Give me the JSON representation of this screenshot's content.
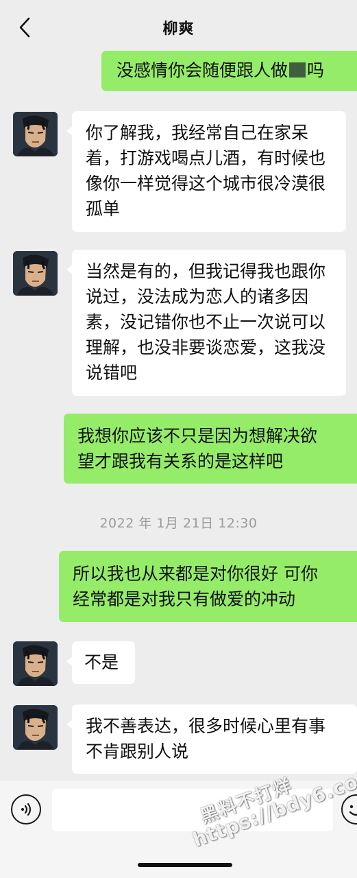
{
  "header": {
    "title": "柳爽",
    "back_icon": "chevron-left-icon"
  },
  "messages": [
    {
      "side": "right",
      "parts": [
        "没感情你会随便跟人做",
        "吗"
      ]
    },
    {
      "side": "left",
      "lines": [
        "你了解我，我经常自己在家呆",
        "着，打游戏喝点儿酒，有时候也",
        "像你一样觉得这个城市很冷漠很",
        "孤单"
      ]
    },
    {
      "side": "left",
      "lines": [
        "当然是有的，但我记得我也跟你",
        "说过，没法成为恋人的诸多因",
        "素，没记错你也不止一次说可以",
        "理解，也没非要谈恋爱，这我没",
        "说错吧"
      ]
    },
    {
      "side": "right",
      "lines": [
        "我想你应该不只是因为想解决欲",
        "望才跟我有关系的是这样吧"
      ]
    },
    {
      "side": "right",
      "lines": [
        "所以我也从来都是对你很好 可你",
        "经常都是对我只有做爱的冲动"
      ]
    },
    {
      "side": "left",
      "lines": [
        "不是"
      ]
    },
    {
      "side": "left",
      "lines": [
        "我不善表达，很多时候心里有事",
        "不肯跟别人说"
      ]
    }
  ],
  "timestamp": "2022 年 1月 21日 12:30",
  "input_bar": {
    "voice_icon": "voice-icon",
    "emoji_icon": "emoji-icon"
  },
  "watermark": {
    "line1": "黑料不打烊",
    "line2": "https://bdy6.co"
  },
  "colors": {
    "sent_bubble": "#95ec69",
    "received_bubble": "#ffffff",
    "background": "#ededed"
  }
}
